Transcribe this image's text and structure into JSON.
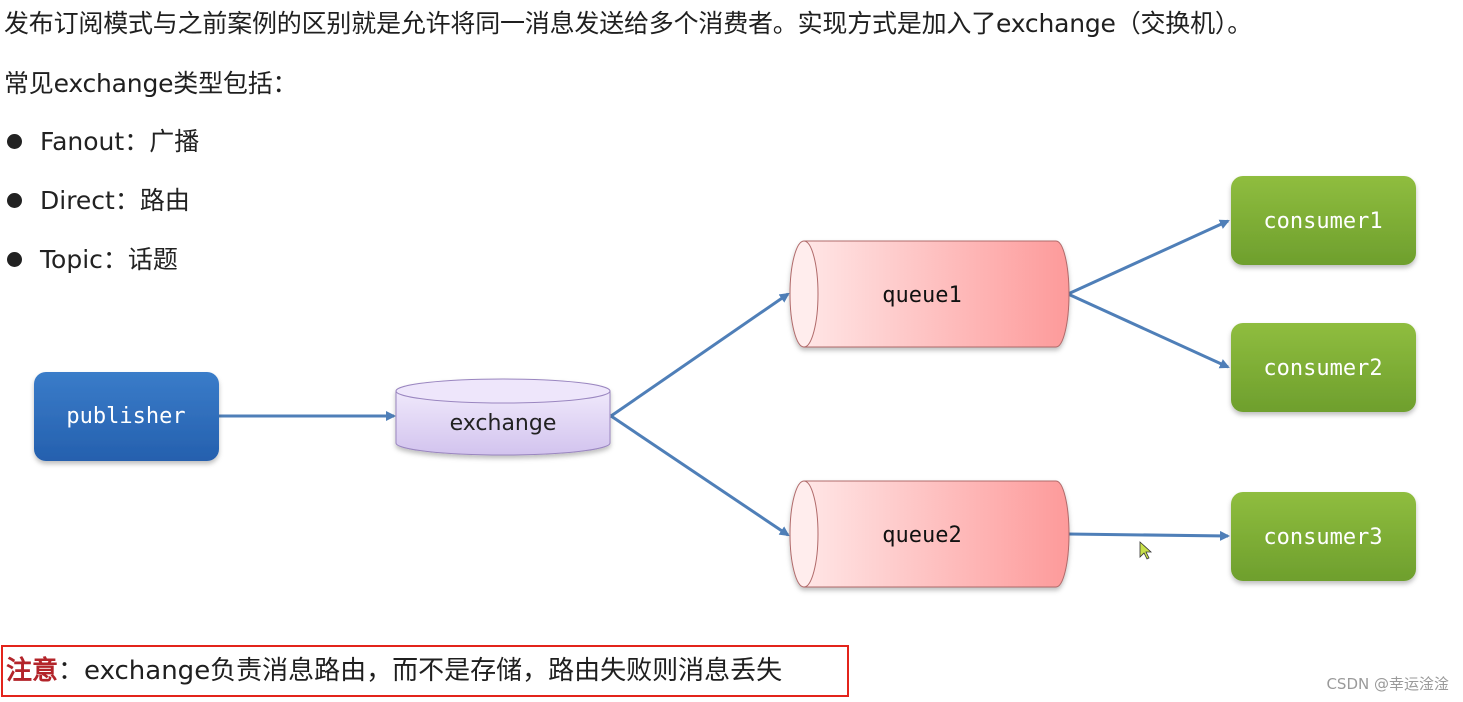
{
  "intro": "发布订阅模式与之前案例的区别就是允许将同一消息发送给多个消费者。实现方式是加入了exchange（交换机）。",
  "types_heading": "常见exchange类型包括：",
  "exchange_types": [
    {
      "name": "Fanout",
      "sep": "：",
      "desc": "广播"
    },
    {
      "name": "Direct",
      "sep": "：",
      "desc": "路由"
    },
    {
      "name": "Topic",
      "sep": "：",
      "desc": "话题"
    }
  ],
  "diagram": {
    "publisher": {
      "label": "publisher",
      "color": "#2f6ebd"
    },
    "exchange": {
      "label": "exchange",
      "color": "#d9cdf0"
    },
    "queues": [
      {
        "id": "queue1",
        "label": "queue1"
      },
      {
        "id": "queue2",
        "label": "queue2"
      }
    ],
    "consumers": [
      {
        "id": "consumer1",
        "label": "consumer1"
      },
      {
        "id": "consumer2",
        "label": "consumer2"
      },
      {
        "id": "consumer3",
        "label": "consumer3"
      }
    ],
    "edges": [
      {
        "from": "publisher",
        "to": "exchange"
      },
      {
        "from": "exchange",
        "to": "queue1"
      },
      {
        "from": "exchange",
        "to": "queue2"
      },
      {
        "from": "queue1",
        "to": "consumer1"
      },
      {
        "from": "queue1",
        "to": "consumer2"
      },
      {
        "from": "queue2",
        "to": "consumer3"
      }
    ],
    "arrow_color": "#4f7fb8",
    "queue_color": "#fd9b9b",
    "consumer_color": "#7fae35"
  },
  "note": {
    "label": "注意",
    "sep": "：",
    "text": "exchange负责消息路由，而不是存储，路由失败则消息丢失",
    "label_color": "#b3242a",
    "border_color": "#e3241b"
  },
  "watermark": "CSDN @幸运淦淦"
}
